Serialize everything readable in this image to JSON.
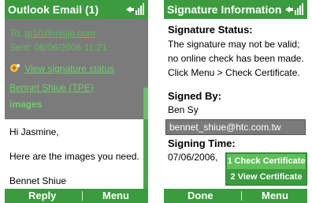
{
  "left": {
    "title": "Outlook Email (1)",
    "to_label": "To:",
    "to_value": "tp10@misip.com",
    "sent_label": "Sent:",
    "sent_value": "06/06/2006 11:21",
    "signature_link": "View signature status",
    "from": "Bennet Shiue (TPE)",
    "subject": "images",
    "body": [
      "Hi Jasmine,",
      "Here are the images you need.",
      "Bennet Shiue"
    ],
    "softkeys": {
      "left": "Reply",
      "right": "Menu"
    }
  },
  "right": {
    "title": "Signature Information",
    "status_heading": "Signature Status:",
    "status_lines": [
      "The signature may not be valid;",
      "no online check has been made.",
      "Click Menu > Check Certificate."
    ],
    "signed_by_heading": "Signed By:",
    "signed_by_name": "Ben Sy",
    "signed_by_email": "bennet_shiue@htc.com.tw",
    "signing_time_heading": "Signing Time:",
    "signing_time_value": "07/06/2006,",
    "menu_items": [
      "1 Check Certificate",
      "2 View Certificate"
    ],
    "softkeys": {
      "left": "Done",
      "right": "Menu"
    }
  },
  "colors": {
    "accent": "#3b9b3e",
    "header_gray": "#7b7b7b",
    "link_green": "#6ecf6a"
  }
}
